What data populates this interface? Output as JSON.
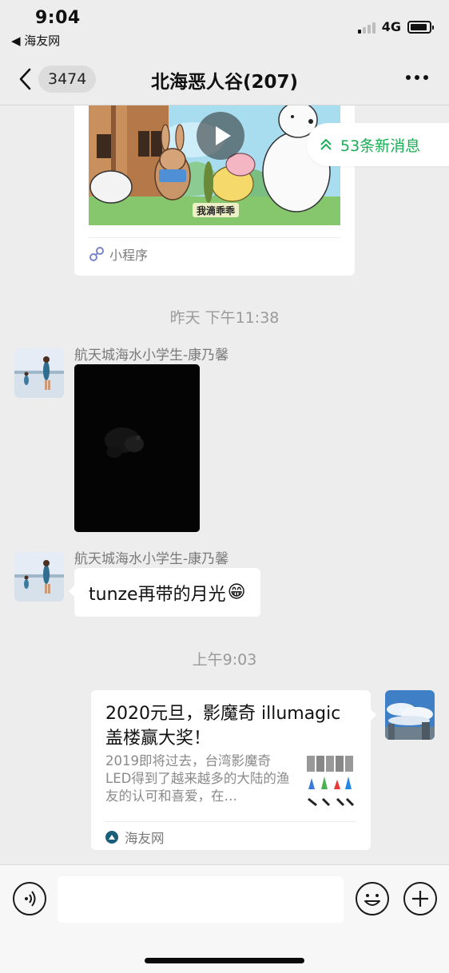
{
  "status_bar": {
    "time": "9:04",
    "back_app": "◀ 海友网",
    "network": "4G",
    "signal_bars": 1,
    "battery_level": 0.9
  },
  "nav": {
    "unread_count": "3474",
    "title": "北海恶人谷(207)"
  },
  "colors": {
    "background": "#EDEDED",
    "accent_green": "#1AAD56",
    "bubble": "#FFFFFF",
    "secondary_text": "#7A7A7A"
  },
  "mini_program_card": {
    "caption": "我滴乖乖",
    "footer_label": "小程序",
    "footer_icon": "mini-program-link-icon",
    "play_icon": "play-icon"
  },
  "new_messages": {
    "label": "53条新消息",
    "icon": "double-chevron-up-icon"
  },
  "messages": [
    {
      "type": "time",
      "text": "昨天 下午11:38"
    },
    {
      "type": "image",
      "sender": "航天城海水小学生-康乃馨"
    },
    {
      "type": "text",
      "sender": "航天城海水小学生-康乃馨",
      "text": "tunze再带的月光",
      "emoji": "😁"
    },
    {
      "type": "time",
      "text": "上午9:03"
    },
    {
      "type": "link",
      "title": "2020元旦，影魔奇 illumagic 盖楼赢大奖！",
      "description": "2019即将过去，台湾影魔奇LED得到了越来越多的大陆的渔友的认可和喜爱，在…",
      "source": "海友网"
    }
  ],
  "input_bar": {
    "voice_icon": "voice-icon",
    "emoji_icon": "emoji-icon",
    "plus_icon": "plus-icon",
    "placeholder": ""
  }
}
